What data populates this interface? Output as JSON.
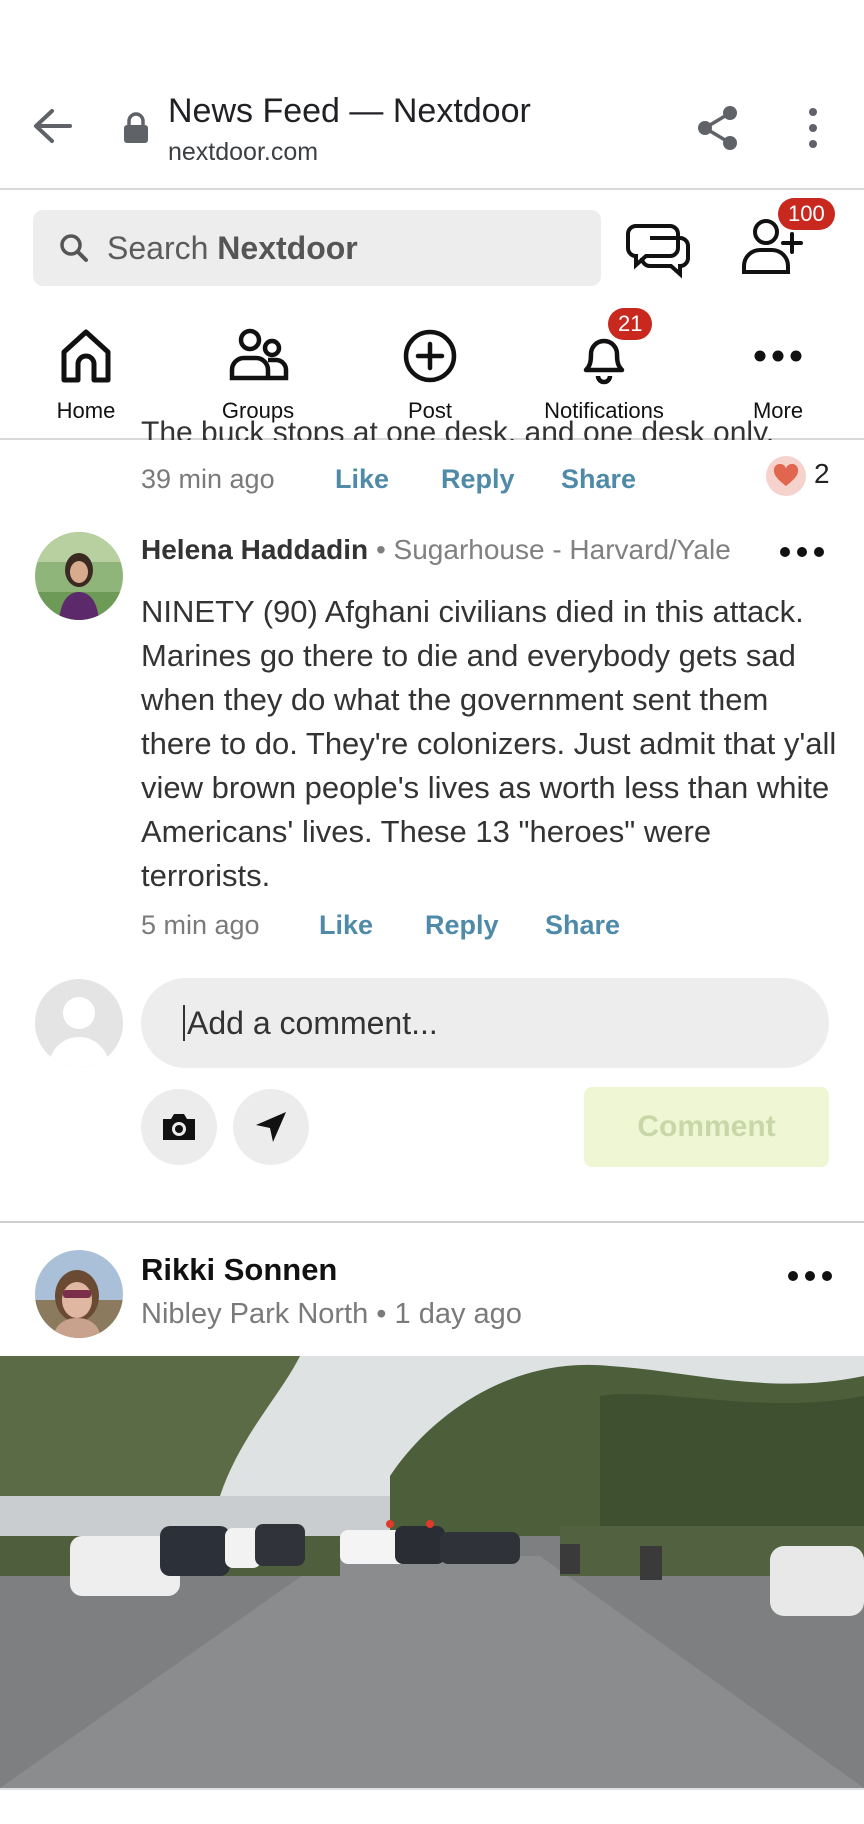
{
  "browser": {
    "title": "News Feed — Nextdoor",
    "url": "nextdoor.com"
  },
  "header": {
    "search_prefix": "Search",
    "search_brand": "Nextdoor",
    "invite_badge": "100"
  },
  "nav": {
    "items": [
      {
        "label": "Home",
        "icon": "home-icon"
      },
      {
        "label": "Groups",
        "icon": "groups-icon"
      },
      {
        "label": "Post",
        "icon": "post-icon"
      },
      {
        "label": "Notifications",
        "icon": "bell-icon",
        "badge": "21"
      },
      {
        "label": "More",
        "icon": "more-icon"
      }
    ]
  },
  "previous_comment": {
    "cut_text": "The buck stops at one desk, and one desk only.",
    "time": "39 min ago",
    "like": "Like",
    "reply": "Reply",
    "share": "Share",
    "reaction_count": "2"
  },
  "comment": {
    "author": "Helena Haddadin",
    "separator": "•",
    "neighborhood": "Sugarhouse - Harvard/Yale",
    "body": "NINETY (90) Afghani civilians died in this attack. Marines go there to die and everybody gets sad when they do what the government sent them there to do. They're colonizers. Just admit that y'all view brown people's lives as worth less than white Americans' lives. These 13 \"heroes\" were terrorists.",
    "time": "5 min ago",
    "like": "Like",
    "reply": "Reply",
    "share": "Share"
  },
  "composer": {
    "placeholder": "Add a comment...",
    "submit": "Comment"
  },
  "post": {
    "author": "Rikki Sonnen",
    "meta": "Nibley Park North • 1 day ago"
  },
  "colors": {
    "accent_link": "#4f8aa8",
    "badge_red": "#c8281e",
    "comment_btn_bg": "#eef6d3"
  }
}
